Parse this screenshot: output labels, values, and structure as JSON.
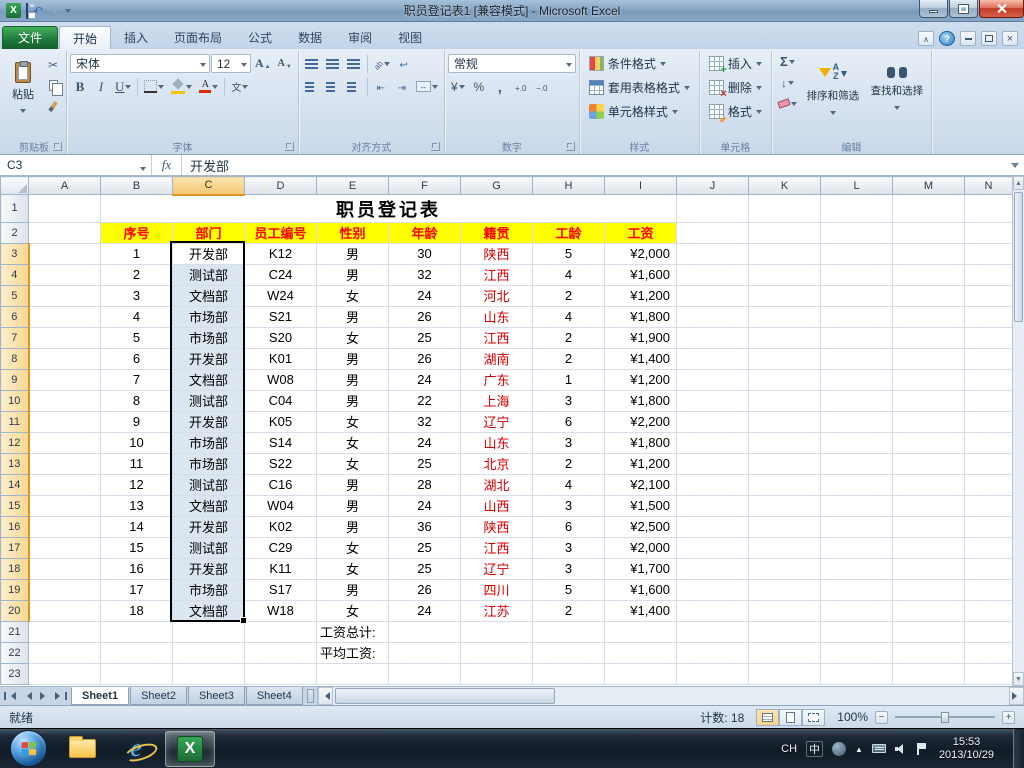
{
  "window": {
    "title": "职员登记表1  [兼容模式] -  Microsoft Excel"
  },
  "ribbon": {
    "file_tab": "文件",
    "active_tab": "开始",
    "tabs": [
      "开始",
      "插入",
      "页面布局",
      "公式",
      "数据",
      "审阅",
      "视图"
    ],
    "clipboard": {
      "label": "剪贴板",
      "paste": "粘贴"
    },
    "font": {
      "label": "字体",
      "name": "宋体",
      "size": "12"
    },
    "alignment": {
      "label": "对齐方式"
    },
    "number": {
      "label": "数字",
      "format": "常规"
    },
    "styles": {
      "label": "样式",
      "items": [
        "条件格式",
        "套用表格格式",
        "单元格样式"
      ]
    },
    "cells": {
      "label": "单元格",
      "items": [
        "插入",
        "删除",
        "格式"
      ]
    },
    "editing": {
      "label": "编辑",
      "sort": "排序和筛选",
      "find": "查找和选择"
    }
  },
  "formula_bar": {
    "name_box": "C3",
    "fx_label": "fx",
    "content": "开发部"
  },
  "sheet": {
    "columns": [
      "A",
      "B",
      "C",
      "D",
      "E",
      "F",
      "G",
      "H",
      "I",
      "J",
      "K",
      "L",
      "M",
      "N"
    ],
    "visible_rows": 23,
    "title": "职员登记表",
    "header_labels": [
      "序号",
      "部门",
      "员工编号",
      "性别",
      "年龄",
      "籍贯",
      "工龄",
      "工资"
    ],
    "data_rows": [
      [
        "1",
        "开发部",
        "K12",
        "男",
        "30",
        "陕西",
        "5",
        "¥2,000"
      ],
      [
        "2",
        "测试部",
        "C24",
        "男",
        "32",
        "江西",
        "4",
        "¥1,600"
      ],
      [
        "3",
        "文档部",
        "W24",
        "女",
        "24",
        "河北",
        "2",
        "¥1,200"
      ],
      [
        "4",
        "市场部",
        "S21",
        "男",
        "26",
        "山东",
        "4",
        "¥1,800"
      ],
      [
        "5",
        "市场部",
        "S20",
        "女",
        "25",
        "江西",
        "2",
        "¥1,900"
      ],
      [
        "6",
        "开发部",
        "K01",
        "男",
        "26",
        "湖南",
        "2",
        "¥1,400"
      ],
      [
        "7",
        "文档部",
        "W08",
        "男",
        "24",
        "广东",
        "1",
        "¥1,200"
      ],
      [
        "8",
        "测试部",
        "C04",
        "男",
        "22",
        "上海",
        "3",
        "¥1,800"
      ],
      [
        "9",
        "开发部",
        "K05",
        "女",
        "32",
        "辽宁",
        "6",
        "¥2,200"
      ],
      [
        "10",
        "市场部",
        "S14",
        "女",
        "24",
        "山东",
        "3",
        "¥1,800"
      ],
      [
        "11",
        "市场部",
        "S22",
        "女",
        "25",
        "北京",
        "2",
        "¥1,200"
      ],
      [
        "12",
        "测试部",
        "C16",
        "男",
        "28",
        "湖北",
        "4",
        "¥2,100"
      ],
      [
        "13",
        "文档部",
        "W04",
        "男",
        "24",
        "山西",
        "3",
        "¥1,500"
      ],
      [
        "14",
        "开发部",
        "K02",
        "男",
        "36",
        "陕西",
        "6",
        "¥2,500"
      ],
      [
        "15",
        "测试部",
        "C29",
        "女",
        "25",
        "江西",
        "3",
        "¥2,000"
      ],
      [
        "16",
        "开发部",
        "K11",
        "女",
        "25",
        "辽宁",
        "3",
        "¥1,700"
      ],
      [
        "17",
        "市场部",
        "S17",
        "男",
        "26",
        "四川",
        "5",
        "¥1,600"
      ],
      [
        "18",
        "文档部",
        "W18",
        "女",
        "24",
        "江苏",
        "2",
        "¥1,400"
      ]
    ],
    "footer_labels": [
      {
        "row": 21,
        "col": "E",
        "text": "工资总计:"
      },
      {
        "row": 22,
        "col": "E",
        "text": "平均工资:"
      }
    ],
    "selection": {
      "range": "C3:C20",
      "active_cell": "C3",
      "column": "C",
      "first_row": 3,
      "last_row": 20
    }
  },
  "sheet_tabs": [
    "Sheet1",
    "Sheet2",
    "Sheet3",
    "Sheet4"
  ],
  "active_sheet": "Sheet1",
  "status_bar": {
    "mode": "就绪",
    "count": "计数: 18",
    "zoom": "100%"
  },
  "taskbar": {
    "lang": "CH",
    "ime": "中",
    "time": "15:53",
    "date": "2013/10/29"
  },
  "colors": {
    "accent_green": "#217a3c",
    "header_fill": "#ffff00",
    "header_text": "#ff0000",
    "selection_fill": "#dce6f1"
  }
}
